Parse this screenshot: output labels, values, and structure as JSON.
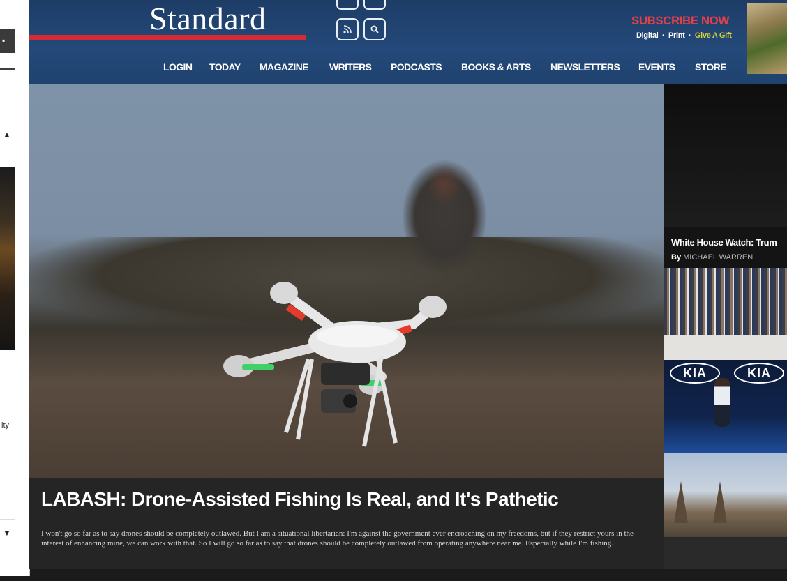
{
  "left_panel": {
    "tab_glyph": "▪",
    "up_arrow": "▲",
    "down_arrow": "▼",
    "fragment_text": "ity"
  },
  "header": {
    "masthead": "Standard",
    "subscribe": {
      "title": "SUBSCRIBE NOW",
      "digital": "Digital",
      "print": "Print",
      "gift": "Give A Gift"
    },
    "social_icons": [
      "rss-icon",
      "search-icon"
    ],
    "nav": [
      "LOGIN",
      "TODAY",
      "MAGAZINE",
      "WRITERS",
      "PODCASTS",
      "BOOKS & ARTS",
      "NEWSLETTERS",
      "EVENTS",
      "STORE"
    ]
  },
  "hero": {
    "image": "drone-photo",
    "headline": "LABASH: Drone-Assisted Fishing Is Real, and It's Pathetic",
    "summary": "I won't go so far as to say drones should be completely outlawed. But I am a situational libertarian: I'm against the government ever encroaching on my freedoms, but if they restrict yours in the interest of enhancing mine, we can work with that. So I will go so far as to say that drones should be completely outlawed from operating anywhere near me. Especially while I'm fishing."
  },
  "rail": {
    "story_title": "White House Watch: Trum",
    "byline_prefix": "By",
    "byline_author": "MICHAEL WARREN",
    "kia_text": "KIA"
  },
  "colors": {
    "header_blue": "#24497a",
    "accent_red": "#d52b35",
    "subscribe_red": "#e0404a",
    "gift_yellow": "#d7d23a"
  }
}
